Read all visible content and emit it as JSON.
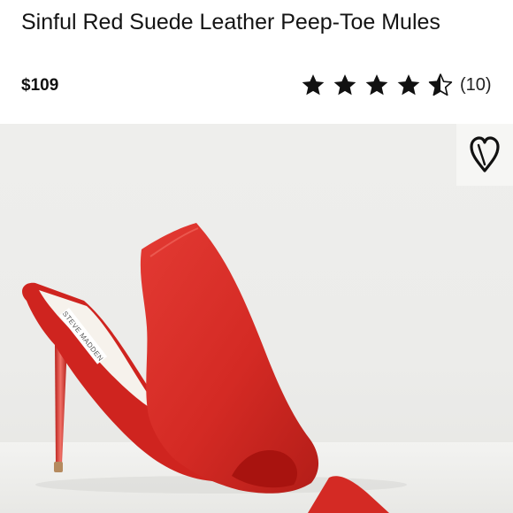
{
  "product": {
    "title": "Sinful Red Suede Leather Peep-Toe Mules",
    "price": "$109",
    "rating_value": 4.5,
    "rating_max": 5,
    "review_count": "(10)"
  },
  "image": {
    "alt": "Red suede peep-toe mule with stiletto heel",
    "insole_brand": "STEVE MADDEN"
  },
  "icons": {
    "wishlist": "heart-icon",
    "star": "star-icon"
  },
  "colors": {
    "suede": "#d42a24",
    "background": "#ececea"
  }
}
